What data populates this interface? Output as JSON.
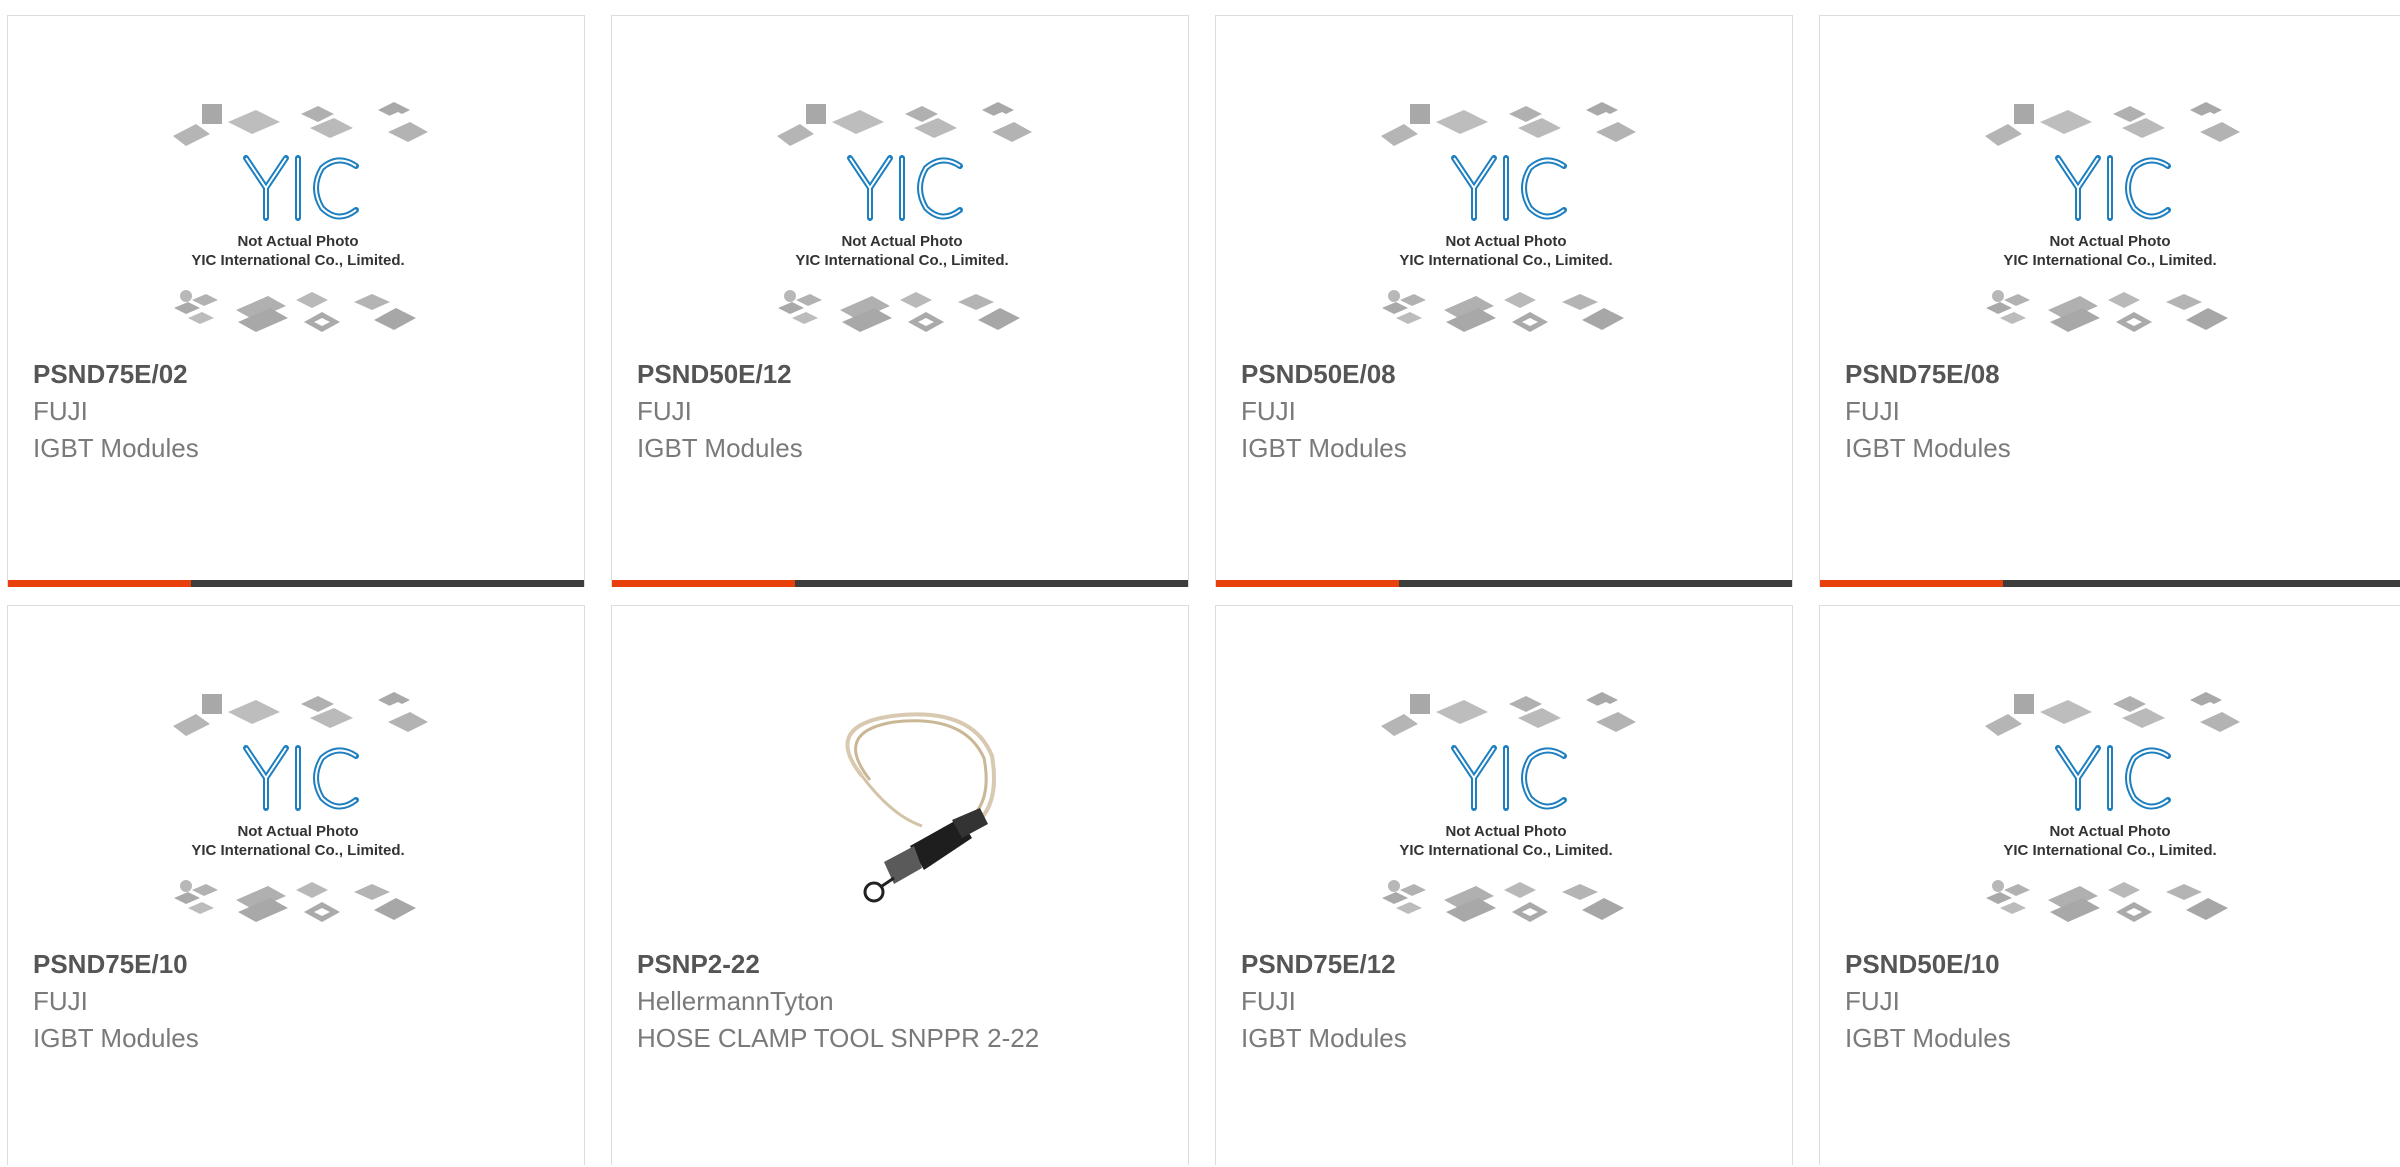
{
  "placeholder": {
    "logo_text": "YIC",
    "line1": "Not Actual Photo",
    "line2": "YIC International Co., Limited."
  },
  "products": [
    {
      "part_number": "PSND75E/02",
      "manufacturer": "FUJI",
      "description": "IGBT Modules",
      "image": "yic-placeholder"
    },
    {
      "part_number": "PSND50E/12",
      "manufacturer": "FUJI",
      "description": "IGBT Modules",
      "image": "yic-placeholder"
    },
    {
      "part_number": "PSND50E/08",
      "manufacturer": "FUJI",
      "description": "IGBT Modules",
      "image": "yic-placeholder"
    },
    {
      "part_number": "PSND75E/08",
      "manufacturer": "FUJI",
      "description": "IGBT Modules",
      "image": "yic-placeholder"
    },
    {
      "part_number": "PSND75E/10",
      "manufacturer": "FUJI",
      "description": "IGBT Modules",
      "image": "yic-placeholder"
    },
    {
      "part_number": "PSNP2-22",
      "manufacturer": "HellermannTyton",
      "description": "HOSE CLAMP TOOL SNPPR 2-22",
      "image": "hose-clamp-tool-photo"
    },
    {
      "part_number": "PSND75E/12",
      "manufacturer": "FUJI",
      "description": "IGBT Modules",
      "image": "yic-placeholder"
    },
    {
      "part_number": "PSND50E/10",
      "manufacturer": "FUJI",
      "description": "IGBT Modules",
      "image": "yic-placeholder"
    }
  ],
  "colors": {
    "accent": "#e8400c",
    "bar": "#3d3d3d",
    "logo_blue": "#1d7fc0"
  }
}
